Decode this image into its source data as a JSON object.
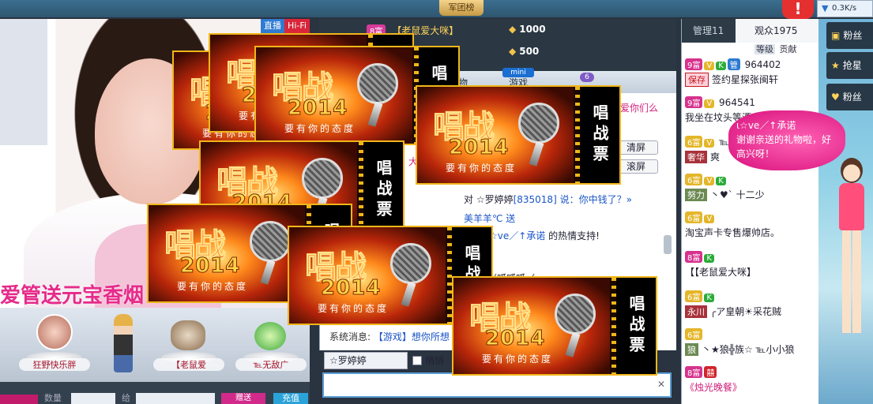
{
  "topbar": {
    "center_tab": "军团榜",
    "alert_icon": "!",
    "netspeed": "0.3K/s"
  },
  "video": {
    "badge_live": "直播",
    "badge_hifi": "Hi-Fi",
    "gift_banner": "爱管送元宝香烟"
  },
  "audience_avatars": [
    {
      "name": "狂野快乐胖"
    },
    {
      "name": ""
    },
    {
      "name": "【老鼠爱"
    },
    {
      "name": "℡无敌广"
    }
  ],
  "bottombar": {
    "label_qty": "数量",
    "label_to": "给",
    "gift_btn": "赠送",
    "send_btn": "充值"
  },
  "ranking": [
    {
      "level": "8富",
      "name": "【老鼠爱大咪】",
      "coins": "1000"
    },
    {
      "level": "",
      "name": "",
      "coins": "500"
    }
  ],
  "center_tabs": {
    "items": [
      "物",
      "游戏"
    ],
    "mini_badge": "mini",
    "count": "6"
  },
  "chat": {
    "line1": "爱你们么",
    "tool_clear": "清屏",
    "tool_stop": "滚屏",
    "line_big": "大",
    "line2_prefix": "对 ☆罗婷婷",
    "line2_id": "[835018]",
    "line2_suffix": " 说：你中钱了？»",
    "line3": "美羊羊℃ 送",
    "line4_name": "☆ve／↑承诺",
    "line4_suffix": " 的热情支持!",
    "line5": "（呱呱呱（",
    "sys_label": "系统消息:",
    "sys_link": "【游戏】想你所想"
  },
  "recipient": "☆罗婷婷",
  "whisper": "悄悄",
  "audience_list": {
    "tab_admin": "管理11",
    "tab_viewers": "观众1975",
    "sub_tabs": [
      "等级",
      "贡献"
    ],
    "rows": [
      {
        "rank": "9富",
        "badges": [
          "V",
          "K",
          "管"
        ],
        "line1": "964402",
        "tag": "保存",
        "tag_style": "r",
        "line2": "签约星探张闽轩"
      },
      {
        "rank": "9富",
        "badges": [
          "V"
        ],
        "line1": "964541",
        "tag": "",
        "line2": "我坐在坟头等漂亮"
      },
      {
        "rank": "6富",
        "badges": [
          "V"
        ],
        "line1": "℡",
        "tag": "奢华",
        "tag_style": "r",
        "line2": "爽"
      },
      {
        "rank": "6富",
        "badges": [
          "V",
          "K"
        ],
        "line1": "",
        "tag": "努力",
        "tag_style": "gr",
        "line2": "丶♥` 十二少"
      },
      {
        "rank": "6富",
        "badges": [
          "V"
        ],
        "line1": "",
        "tag": "",
        "line2": "淘宝声卡专售爆帅店。"
      },
      {
        "rank": "8富",
        "badges": [
          "K"
        ],
        "line1": "",
        "tag": "",
        "line2": "【【老鼠爱大咪】"
      },
      {
        "rank": "6富",
        "badges": [
          "K"
        ],
        "line1": "",
        "tag": "永川",
        "tag_style": "r",
        "line2": "╭ア皇朝☀采花贼"
      },
      {
        "rank": "6富",
        "badges": [],
        "line1": "",
        "tag": "狼",
        "tag_style": "gr",
        "line2": "丶★狼╬族☆ ℡小小狼"
      },
      {
        "rank": "8富",
        "badges": [
          "囍"
        ],
        "line1": "",
        "tag": "",
        "line2": "《烛光晚餐》"
      }
    ]
  },
  "right_panel": {
    "buttons": [
      {
        "icon": "▣",
        "label": "粉丝"
      },
      {
        "icon": "★",
        "label": "抢星"
      },
      {
        "icon": "♥",
        "label": "粉丝"
      }
    ]
  },
  "bubble": {
    "who": "ι☆ve／↑承诺",
    "text": "谢谢亲送的礼物啦，好高兴呀！"
  },
  "ticket": {
    "logo": "唱战",
    "year": "2014",
    "slogan": "要有你的态度",
    "stub": "唱战票"
  },
  "colors": {
    "accent_pink": "#d6338e",
    "fire_orange": "#ff8a1c",
    "ticket_border": "#f0b61a"
  }
}
